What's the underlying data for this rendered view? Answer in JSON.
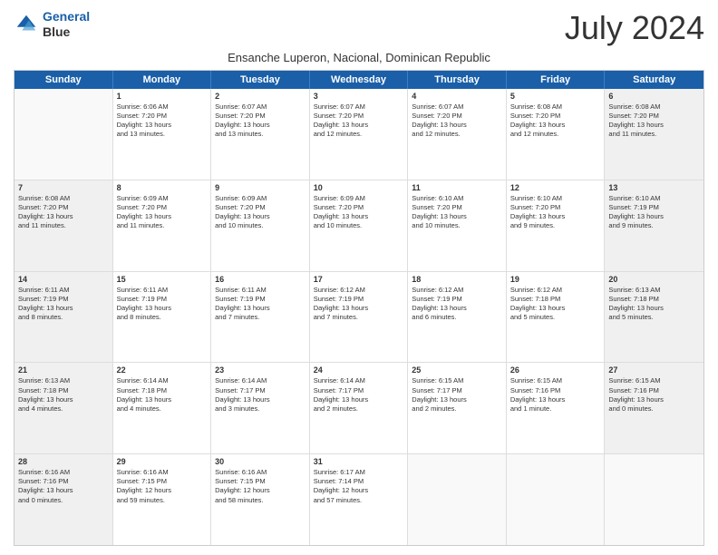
{
  "logo": {
    "line1": "General",
    "line2": "Blue"
  },
  "title": "July 2024",
  "subtitle": "Ensanche Luperon, Nacional, Dominican Republic",
  "header_days": [
    "Sunday",
    "Monday",
    "Tuesday",
    "Wednesday",
    "Thursday",
    "Friday",
    "Saturday"
  ],
  "weeks": [
    [
      {
        "day": "",
        "text": ""
      },
      {
        "day": "1",
        "text": "Sunrise: 6:06 AM\nSunset: 7:20 PM\nDaylight: 13 hours\nand 13 minutes."
      },
      {
        "day": "2",
        "text": "Sunrise: 6:07 AM\nSunset: 7:20 PM\nDaylight: 13 hours\nand 13 minutes."
      },
      {
        "day": "3",
        "text": "Sunrise: 6:07 AM\nSunset: 7:20 PM\nDaylight: 13 hours\nand 12 minutes."
      },
      {
        "day": "4",
        "text": "Sunrise: 6:07 AM\nSunset: 7:20 PM\nDaylight: 13 hours\nand 12 minutes."
      },
      {
        "day": "5",
        "text": "Sunrise: 6:08 AM\nSunset: 7:20 PM\nDaylight: 13 hours\nand 12 minutes."
      },
      {
        "day": "6",
        "text": "Sunrise: 6:08 AM\nSunset: 7:20 PM\nDaylight: 13 hours\nand 11 minutes."
      }
    ],
    [
      {
        "day": "7",
        "text": "Sunrise: 6:08 AM\nSunset: 7:20 PM\nDaylight: 13 hours\nand 11 minutes."
      },
      {
        "day": "8",
        "text": "Sunrise: 6:09 AM\nSunset: 7:20 PM\nDaylight: 13 hours\nand 11 minutes."
      },
      {
        "day": "9",
        "text": "Sunrise: 6:09 AM\nSunset: 7:20 PM\nDaylight: 13 hours\nand 10 minutes."
      },
      {
        "day": "10",
        "text": "Sunrise: 6:09 AM\nSunset: 7:20 PM\nDaylight: 13 hours\nand 10 minutes."
      },
      {
        "day": "11",
        "text": "Sunrise: 6:10 AM\nSunset: 7:20 PM\nDaylight: 13 hours\nand 10 minutes."
      },
      {
        "day": "12",
        "text": "Sunrise: 6:10 AM\nSunset: 7:20 PM\nDaylight: 13 hours\nand 9 minutes."
      },
      {
        "day": "13",
        "text": "Sunrise: 6:10 AM\nSunset: 7:19 PM\nDaylight: 13 hours\nand 9 minutes."
      }
    ],
    [
      {
        "day": "14",
        "text": "Sunrise: 6:11 AM\nSunset: 7:19 PM\nDaylight: 13 hours\nand 8 minutes."
      },
      {
        "day": "15",
        "text": "Sunrise: 6:11 AM\nSunset: 7:19 PM\nDaylight: 13 hours\nand 8 minutes."
      },
      {
        "day": "16",
        "text": "Sunrise: 6:11 AM\nSunset: 7:19 PM\nDaylight: 13 hours\nand 7 minutes."
      },
      {
        "day": "17",
        "text": "Sunrise: 6:12 AM\nSunset: 7:19 PM\nDaylight: 13 hours\nand 7 minutes."
      },
      {
        "day": "18",
        "text": "Sunrise: 6:12 AM\nSunset: 7:19 PM\nDaylight: 13 hours\nand 6 minutes."
      },
      {
        "day": "19",
        "text": "Sunrise: 6:12 AM\nSunset: 7:18 PM\nDaylight: 13 hours\nand 5 minutes."
      },
      {
        "day": "20",
        "text": "Sunrise: 6:13 AM\nSunset: 7:18 PM\nDaylight: 13 hours\nand 5 minutes."
      }
    ],
    [
      {
        "day": "21",
        "text": "Sunrise: 6:13 AM\nSunset: 7:18 PM\nDaylight: 13 hours\nand 4 minutes."
      },
      {
        "day": "22",
        "text": "Sunrise: 6:14 AM\nSunset: 7:18 PM\nDaylight: 13 hours\nand 4 minutes."
      },
      {
        "day": "23",
        "text": "Sunrise: 6:14 AM\nSunset: 7:17 PM\nDaylight: 13 hours\nand 3 minutes."
      },
      {
        "day": "24",
        "text": "Sunrise: 6:14 AM\nSunset: 7:17 PM\nDaylight: 13 hours\nand 2 minutes."
      },
      {
        "day": "25",
        "text": "Sunrise: 6:15 AM\nSunset: 7:17 PM\nDaylight: 13 hours\nand 2 minutes."
      },
      {
        "day": "26",
        "text": "Sunrise: 6:15 AM\nSunset: 7:16 PM\nDaylight: 13 hours\nand 1 minute."
      },
      {
        "day": "27",
        "text": "Sunrise: 6:15 AM\nSunset: 7:16 PM\nDaylight: 13 hours\nand 0 minutes."
      }
    ],
    [
      {
        "day": "28",
        "text": "Sunrise: 6:16 AM\nSunset: 7:16 PM\nDaylight: 13 hours\nand 0 minutes."
      },
      {
        "day": "29",
        "text": "Sunrise: 6:16 AM\nSunset: 7:15 PM\nDaylight: 12 hours\nand 59 minutes."
      },
      {
        "day": "30",
        "text": "Sunrise: 6:16 AM\nSunset: 7:15 PM\nDaylight: 12 hours\nand 58 minutes."
      },
      {
        "day": "31",
        "text": "Sunrise: 6:17 AM\nSunset: 7:14 PM\nDaylight: 12 hours\nand 57 minutes."
      },
      {
        "day": "",
        "text": ""
      },
      {
        "day": "",
        "text": ""
      },
      {
        "day": "",
        "text": ""
      }
    ]
  ]
}
